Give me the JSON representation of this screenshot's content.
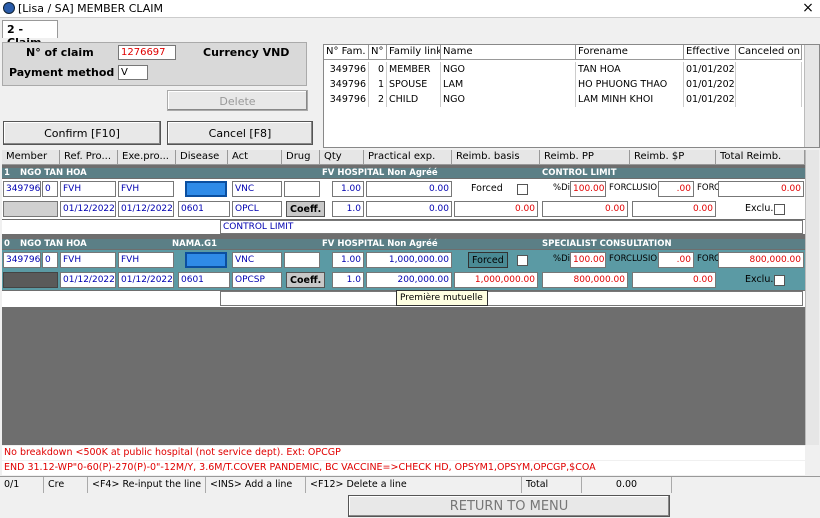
{
  "window": {
    "title": "[Lisa / SA] MEMBER CLAIM",
    "close_label": "×"
  },
  "tab": {
    "label": "2 - Claim"
  },
  "claim": {
    "claim_no_label": "N° of claim",
    "claim_no": "1276697",
    "currency_label": "Currency VND",
    "payment_label": "Payment method",
    "payment_value": "V"
  },
  "buttons": {
    "delete": "Delete",
    "confirm": "Confirm [F10]",
    "cancel": "Cancel [F8]",
    "return": "RETURN TO MENU"
  },
  "family": {
    "headers": [
      "N° Fam.",
      "N°",
      "Family link",
      "Name",
      "Forename",
      "Effective",
      "Canceled on"
    ],
    "rows": [
      [
        "349796",
        "0",
        "MEMBER",
        "NGO",
        "TAN HOA",
        "01/01/2021",
        ""
      ],
      [
        "349796",
        "1",
        "SPOUSE",
        "LAM",
        "HO PHUONG THAO",
        "01/01/2021",
        ""
      ],
      [
        "349796",
        "2",
        "CHILD",
        "NGO",
        "LAM MINH KHOI",
        "01/01/2021",
        ""
      ]
    ]
  },
  "grid": {
    "headers": [
      "Member",
      "Ref. Pro...",
      "Exe.pro...",
      "Disease",
      "Act",
      "Drug",
      "Qty",
      "Practical exp.",
      "Reimb. basis",
      "Reimb. PP",
      "Reimb. $P",
      "Total Reimb."
    ],
    "line1": {
      "idx": "1",
      "member_name": "NGO TAN HOA",
      "provider_label": "FV HOSPITAL Non Agréé",
      "limit_label": "CONTROL LIMIT",
      "member": "349796",
      "member_no": "0",
      "ref": "FVH",
      "exe": "FVH",
      "act": "VNC",
      "qty1": "1.00",
      "exp1": "0.00",
      "forced": "Forced",
      "pct_label": "%Di",
      "pct": "100.00",
      "forclu": "FORCLUSIO",
      "reimb_sp1": ".00",
      "forc": "FORC",
      "total1": "0.00",
      "date_ref": "01/12/2022",
      "date_exe": "01/12/2022",
      "disease": "0601",
      "act2": "OPCL",
      "coeff": "Coeff.",
      "qty2": "1.0",
      "exp2": "0.00",
      "basis2": "0.00",
      "pp2": "0.00",
      "sp2": "0.00",
      "exclu": "Exclu.",
      "note": "CONTROL LIMIT"
    },
    "line2": {
      "idx": "0",
      "member_name": "NGO TAN HOA",
      "doctor": "NAMA.G1",
      "provider_label": "FV HOSPITAL Non Agréé",
      "limit_label": "SPECIALIST CONSULTATION",
      "member": "349796",
      "member_no": "0",
      "ref": "FVH",
      "exe": "FVH",
      "act": "VNC",
      "qty1": "1.00",
      "exp1": "1,000,000.00",
      "forced": "Forced",
      "pct_label": "%Di",
      "pct": "100.00",
      "forclu": "FORCLUSIO",
      "reimb_sp1": ".00",
      "forc": "FORC",
      "total1": "800,000.00",
      "date_ref": "01/12/2022",
      "date_exe": "01/12/2022",
      "disease": "0601",
      "act2": "OPCSP",
      "coeff": "Coeff.",
      "qty2": "1.0",
      "exp2": "200,000.00",
      "basis2": "1,000,000.00",
      "pp2": "800,000.00",
      "sp2": "0.00",
      "exclu": "Exclu."
    },
    "tooltip": "Première mutuelle"
  },
  "messages": {
    "line1": "No breakdown <500K at public hospital (not service dept). Ext: OPCGP",
    "line2": "END 31.12-WP\"0-60(P)-270(P)-0\"-12M/Y, 3.6M/T.COVER PANDEMIC, BC VACCINE=>CHECK HD, OPSYM1,OPSYM,OPCGP,$COA"
  },
  "status": {
    "pos": "0/1",
    "mode": "Cre",
    "hint1": "<F4> Re-input the line",
    "hint2": "<INS> Add a line",
    "hint3": "<F12> Delete a line",
    "total_label": "Total",
    "total": "0.00"
  },
  "colors": {
    "accent_red": "#e00000",
    "row_band": "#5b7f86",
    "selected_row": "#5b9aa4",
    "selected_cell": "#2f8be8"
  }
}
